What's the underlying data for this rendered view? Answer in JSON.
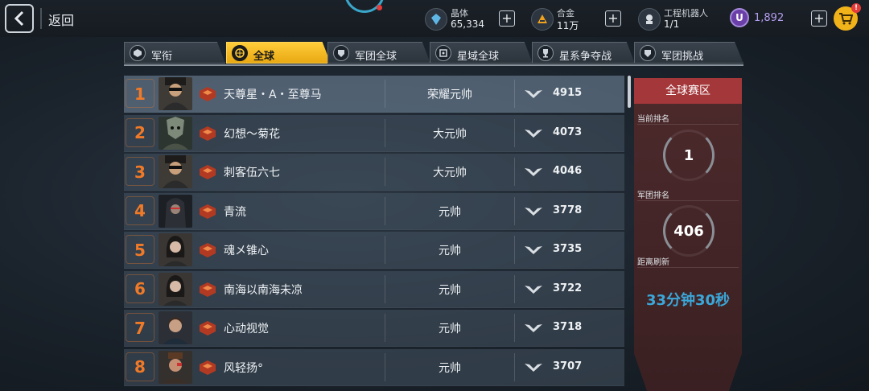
{
  "top": {
    "back_label": "返回",
    "resources": [
      {
        "icon": "crystal-icon",
        "label": "晶体",
        "value": "65,334"
      },
      {
        "icon": "alloy-icon",
        "label": "合金",
        "value": "11万"
      },
      {
        "icon": "robot-icon",
        "label": "工程机器人",
        "value": "1/1"
      }
    ],
    "premium": {
      "icon": "u-coin-icon",
      "symbol": "U",
      "value": "1,892"
    },
    "cart_badge": "!"
  },
  "tabs": [
    {
      "label": "军衔",
      "icon": "rank-insignia-icon",
      "active": false
    },
    {
      "label": "全球",
      "icon": "globe-icon",
      "active": true
    },
    {
      "label": "军团全球",
      "icon": "legion-icon",
      "active": false
    },
    {
      "label": "星域全球",
      "icon": "star-domain-icon",
      "active": false
    },
    {
      "label": "星系争夺战",
      "icon": "trophy-icon",
      "active": false
    },
    {
      "label": "军团挑战",
      "icon": "legion-challenge-icon",
      "active": false
    }
  ],
  "rankings": [
    {
      "rank": "1",
      "name": "天尊星・A・至尊马",
      "title": "荣耀元帅",
      "score": "4915"
    },
    {
      "rank": "2",
      "name": "幻想～菊花",
      "title": "大元帅",
      "score": "4073"
    },
    {
      "rank": "3",
      "name": "刺客伍六七",
      "title": "大元帅",
      "score": "4046"
    },
    {
      "rank": "4",
      "name": "青流",
      "title": "元帅",
      "score": "3778"
    },
    {
      "rank": "5",
      "name": "魂メ锥心",
      "title": "元帅",
      "score": "3735"
    },
    {
      "rank": "6",
      "name": "南海以南海未凉",
      "title": "元帅",
      "score": "3722"
    },
    {
      "rank": "7",
      "name": "心动视觉",
      "title": "元帅",
      "score": "3718"
    },
    {
      "rank": "8",
      "name": "风轻扬°",
      "title": "元帅",
      "score": "3707"
    }
  ],
  "panel": {
    "header": "全球赛区",
    "current_rank_label": "当前排名",
    "current_rank": "1",
    "legion_rank_label": "军团排名",
    "legion_rank": "406",
    "refresh_label": "距离刷新",
    "refresh_time": "33分钟30秒"
  },
  "colors": {
    "accent_tab": "#f5b91e",
    "rank_number": "#f07a28",
    "timer": "#3ba7d9",
    "panel_header": "#a3373a"
  }
}
